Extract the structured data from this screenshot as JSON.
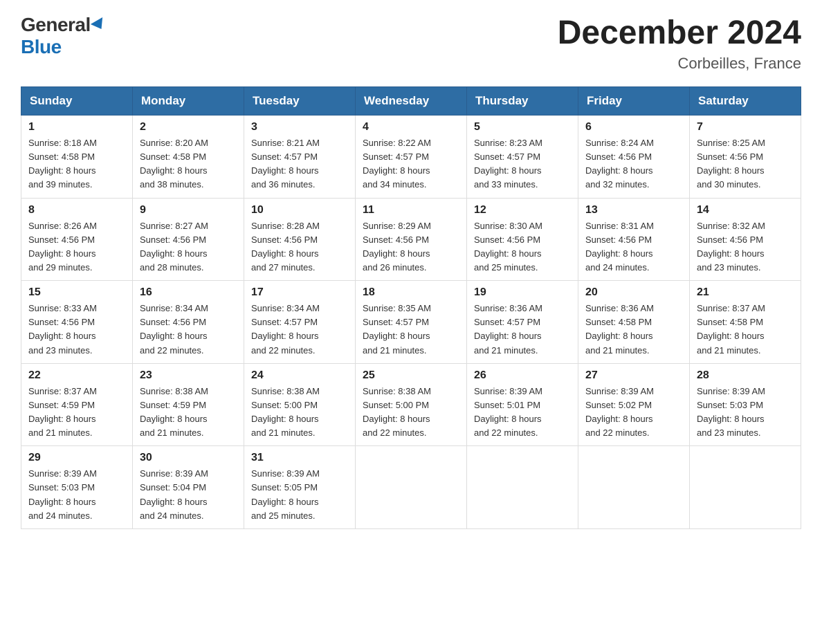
{
  "header": {
    "logo_general": "General",
    "logo_blue": "Blue",
    "title": "December 2024",
    "subtitle": "Corbeilles, France"
  },
  "days_of_week": [
    "Sunday",
    "Monday",
    "Tuesday",
    "Wednesday",
    "Thursday",
    "Friday",
    "Saturday"
  ],
  "weeks": [
    [
      {
        "day": "1",
        "sunrise": "8:18 AM",
        "sunset": "4:58 PM",
        "daylight": "8 hours and 39 minutes."
      },
      {
        "day": "2",
        "sunrise": "8:20 AM",
        "sunset": "4:58 PM",
        "daylight": "8 hours and 38 minutes."
      },
      {
        "day": "3",
        "sunrise": "8:21 AM",
        "sunset": "4:57 PM",
        "daylight": "8 hours and 36 minutes."
      },
      {
        "day": "4",
        "sunrise": "8:22 AM",
        "sunset": "4:57 PM",
        "daylight": "8 hours and 34 minutes."
      },
      {
        "day": "5",
        "sunrise": "8:23 AM",
        "sunset": "4:57 PM",
        "daylight": "8 hours and 33 minutes."
      },
      {
        "day": "6",
        "sunrise": "8:24 AM",
        "sunset": "4:56 PM",
        "daylight": "8 hours and 32 minutes."
      },
      {
        "day": "7",
        "sunrise": "8:25 AM",
        "sunset": "4:56 PM",
        "daylight": "8 hours and 30 minutes."
      }
    ],
    [
      {
        "day": "8",
        "sunrise": "8:26 AM",
        "sunset": "4:56 PM",
        "daylight": "8 hours and 29 minutes."
      },
      {
        "day": "9",
        "sunrise": "8:27 AM",
        "sunset": "4:56 PM",
        "daylight": "8 hours and 28 minutes."
      },
      {
        "day": "10",
        "sunrise": "8:28 AM",
        "sunset": "4:56 PM",
        "daylight": "8 hours and 27 minutes."
      },
      {
        "day": "11",
        "sunrise": "8:29 AM",
        "sunset": "4:56 PM",
        "daylight": "8 hours and 26 minutes."
      },
      {
        "day": "12",
        "sunrise": "8:30 AM",
        "sunset": "4:56 PM",
        "daylight": "8 hours and 25 minutes."
      },
      {
        "day": "13",
        "sunrise": "8:31 AM",
        "sunset": "4:56 PM",
        "daylight": "8 hours and 24 minutes."
      },
      {
        "day": "14",
        "sunrise": "8:32 AM",
        "sunset": "4:56 PM",
        "daylight": "8 hours and 23 minutes."
      }
    ],
    [
      {
        "day": "15",
        "sunrise": "8:33 AM",
        "sunset": "4:56 PM",
        "daylight": "8 hours and 23 minutes."
      },
      {
        "day": "16",
        "sunrise": "8:34 AM",
        "sunset": "4:56 PM",
        "daylight": "8 hours and 22 minutes."
      },
      {
        "day": "17",
        "sunrise": "8:34 AM",
        "sunset": "4:57 PM",
        "daylight": "8 hours and 22 minutes."
      },
      {
        "day": "18",
        "sunrise": "8:35 AM",
        "sunset": "4:57 PM",
        "daylight": "8 hours and 21 minutes."
      },
      {
        "day": "19",
        "sunrise": "8:36 AM",
        "sunset": "4:57 PM",
        "daylight": "8 hours and 21 minutes."
      },
      {
        "day": "20",
        "sunrise": "8:36 AM",
        "sunset": "4:58 PM",
        "daylight": "8 hours and 21 minutes."
      },
      {
        "day": "21",
        "sunrise": "8:37 AM",
        "sunset": "4:58 PM",
        "daylight": "8 hours and 21 minutes."
      }
    ],
    [
      {
        "day": "22",
        "sunrise": "8:37 AM",
        "sunset": "4:59 PM",
        "daylight": "8 hours and 21 minutes."
      },
      {
        "day": "23",
        "sunrise": "8:38 AM",
        "sunset": "4:59 PM",
        "daylight": "8 hours and 21 minutes."
      },
      {
        "day": "24",
        "sunrise": "8:38 AM",
        "sunset": "5:00 PM",
        "daylight": "8 hours and 21 minutes."
      },
      {
        "day": "25",
        "sunrise": "8:38 AM",
        "sunset": "5:00 PM",
        "daylight": "8 hours and 22 minutes."
      },
      {
        "day": "26",
        "sunrise": "8:39 AM",
        "sunset": "5:01 PM",
        "daylight": "8 hours and 22 minutes."
      },
      {
        "day": "27",
        "sunrise": "8:39 AM",
        "sunset": "5:02 PM",
        "daylight": "8 hours and 22 minutes."
      },
      {
        "day": "28",
        "sunrise": "8:39 AM",
        "sunset": "5:03 PM",
        "daylight": "8 hours and 23 minutes."
      }
    ],
    [
      {
        "day": "29",
        "sunrise": "8:39 AM",
        "sunset": "5:03 PM",
        "daylight": "8 hours and 24 minutes."
      },
      {
        "day": "30",
        "sunrise": "8:39 AM",
        "sunset": "5:04 PM",
        "daylight": "8 hours and 24 minutes."
      },
      {
        "day": "31",
        "sunrise": "8:39 AM",
        "sunset": "5:05 PM",
        "daylight": "8 hours and 25 minutes."
      },
      null,
      null,
      null,
      null
    ]
  ],
  "labels": {
    "sunrise": "Sunrise:",
    "sunset": "Sunset:",
    "daylight": "Daylight:"
  }
}
